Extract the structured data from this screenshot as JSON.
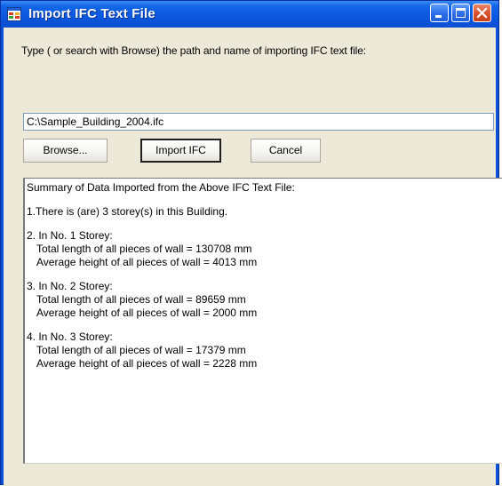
{
  "window": {
    "title": "Import IFC Text File",
    "icon": "app-form-icon"
  },
  "caption_buttons": {
    "minimize_icon": "minimize-icon",
    "maximize_icon": "maximize-icon",
    "close_icon": "close-icon"
  },
  "form": {
    "instruction": "Type ( or search with Browse) the path and name of importing IFC text file:",
    "path_value": "C:\\Sample_Building_2004.ifc",
    "browse_label": "Browse...",
    "import_label": "Import IFC",
    "cancel_label": "Cancel"
  },
  "summary": {
    "heading": "Summary of Data Imported from the Above IFC Text File:",
    "storey_count_line": "1.There is (are) 3 storey(s) in this Building.",
    "storeys": [
      {
        "header": "2. In No. 1 Storey:",
        "length_line": "Total length of all pieces of wall = 130708 mm",
        "height_line": "Average height of all pieces of wall = 4013 mm"
      },
      {
        "header": "3. In No. 2 Storey:",
        "length_line": "Total length of all pieces of wall = 89659 mm",
        "height_line": "Average height of all pieces of wall = 2000 mm"
      },
      {
        "header": "4. In No. 3 Storey:",
        "length_line": "Total length of all pieces of wall = 17379 mm",
        "height_line": "Average height of all pieces of wall = 2228 mm"
      }
    ]
  },
  "colors": {
    "titlebar": "#0a57df",
    "client_bg": "#ece9d8",
    "close_button": "#d9502b"
  }
}
